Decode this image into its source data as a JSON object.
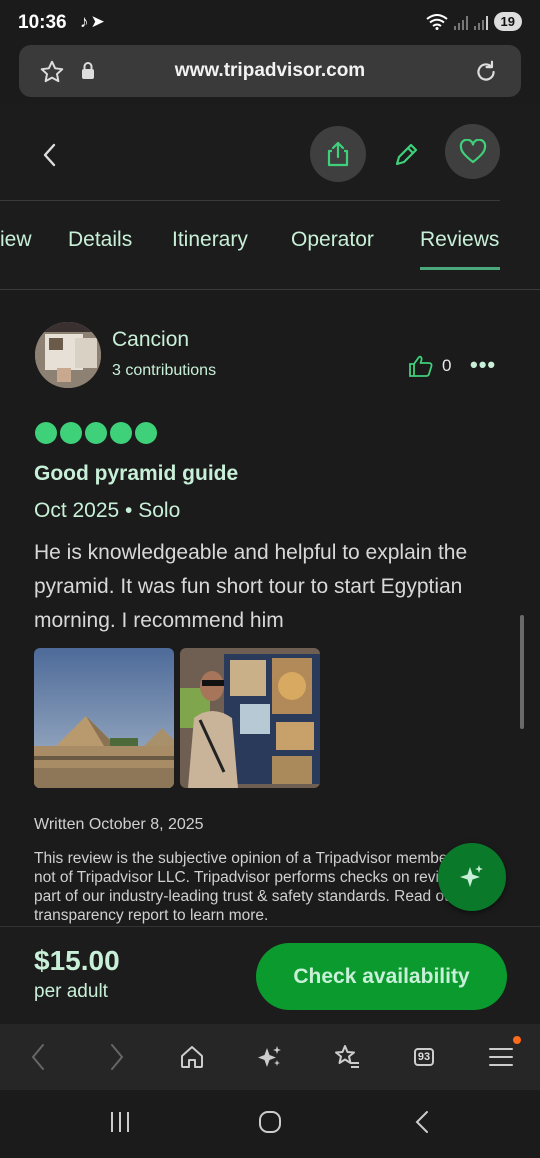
{
  "status": {
    "time": "10:36",
    "app_icons": "♪➤",
    "battery": "19"
  },
  "browser": {
    "url": "www.tripadvisor.com",
    "tab_count": "93"
  },
  "tabs": [
    {
      "label": "iew"
    },
    {
      "label": "Details"
    },
    {
      "label": "Itinerary"
    },
    {
      "label": "Operator"
    },
    {
      "label": "Reviews",
      "active": true
    }
  ],
  "review": {
    "reviewer": "Cancion",
    "contributions": "3 contributions",
    "likes": "0",
    "rating": 5,
    "title": "Good pyramid guide",
    "meta": "Oct 2025 • Solo",
    "body": "He is knowledgeable and helpful to explain the pyramid. It was fun short tour to start Egyptian morning. I recommend him",
    "written": "Written October 8, 2025",
    "disclaimer": "This review is the subjective opinion of a Tripadvisor member and not of Tripadvisor LLC. Tripadvisor performs checks on reviews as part of our industry-leading trust & safety standards. Read our transparency report to learn more."
  },
  "booking": {
    "price": "$15.00",
    "unit": "per adult",
    "cta": "Check availability"
  },
  "colors": {
    "accent": "#c8f0d8",
    "bubble": "#3fd07a",
    "cta": "#0b9a2d",
    "fab": "#0a7a2a"
  }
}
